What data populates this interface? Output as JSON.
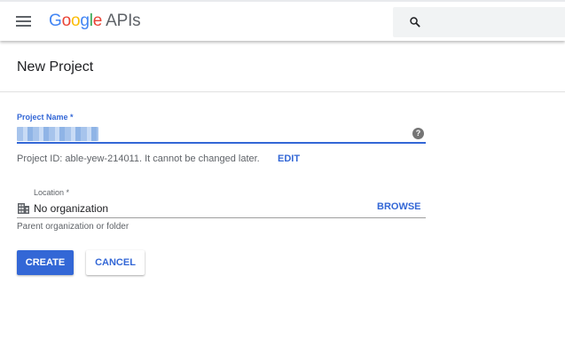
{
  "header": {
    "logo": {
      "letters": [
        "G",
        "o",
        "o",
        "g",
        "l",
        "e"
      ],
      "suffix": "APIs"
    },
    "icons": {
      "menu": "menu-icon",
      "search": "search-icon"
    }
  },
  "page": {
    "title": "New Project"
  },
  "form": {
    "project_name": {
      "label": "Project Name *",
      "value_redacted": true,
      "help_icon": "help-icon"
    },
    "project_id": {
      "text": "Project ID: able-yew-214011. It cannot be changed later.",
      "edit_label": "EDIT"
    },
    "location": {
      "label": "Location *",
      "icon": "building-icon",
      "value": "No organization",
      "browse_label": "BROWSE",
      "hint": "Parent organization or folder"
    },
    "buttons": {
      "create": "CREATE",
      "cancel": "CANCEL"
    }
  },
  "colors": {
    "accent": "#3367d6",
    "text": "#202124",
    "muted": "#5f6368"
  }
}
